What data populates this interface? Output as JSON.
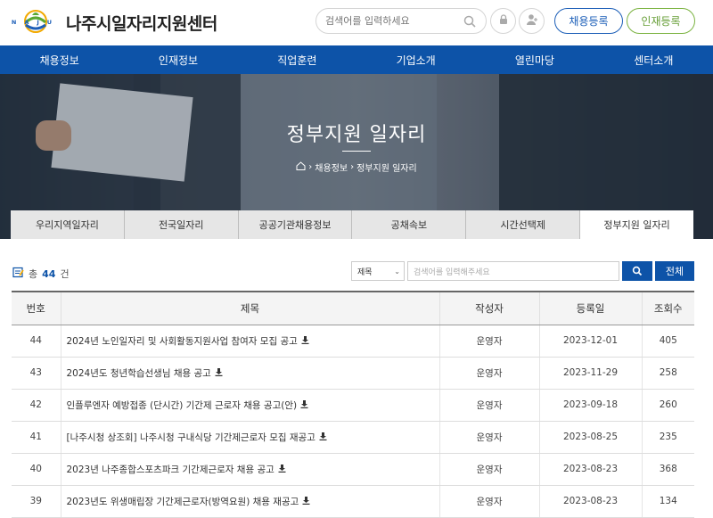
{
  "brand": {
    "logo_text": "NAJU",
    "title": "나주시일자리지원센터"
  },
  "top_search": {
    "placeholder": "검색어를 입력하세요"
  },
  "top_buttons": {
    "register_job": "채용등록",
    "register_talent": "인재등록"
  },
  "nav": [
    "채용정보",
    "인재정보",
    "직업훈련",
    "기업소개",
    "열린마당",
    "센터소개"
  ],
  "banner": {
    "title": "정부지원 일자리",
    "breadcrumb": [
      "채용정보",
      "정부지원 일자리"
    ]
  },
  "tabs": [
    {
      "label": "우리지역일자리",
      "active": false
    },
    {
      "label": "전국일자리",
      "active": false
    },
    {
      "label": "공공기관채용정보",
      "active": false
    },
    {
      "label": "공채속보",
      "active": false
    },
    {
      "label": "시간선택제",
      "active": false
    },
    {
      "label": "정부지원 일자리",
      "active": true
    }
  ],
  "list": {
    "count_prefix": "총",
    "count": "44",
    "count_suffix": "건",
    "select_value": "제목",
    "search_placeholder": "검색어를 입력해주세요",
    "all_button": "전체"
  },
  "table": {
    "headers": [
      "번호",
      "제목",
      "작성자",
      "등록일",
      "조회수"
    ],
    "rows": [
      {
        "no": "44",
        "title": "2024년 노인일자리 및 사회활동지원사업 참여자 모집 공고",
        "author": "운영자",
        "date": "2023-12-01",
        "views": "405"
      },
      {
        "no": "43",
        "title": "2024년도 청년학습선생님 채용 공고",
        "author": "운영자",
        "date": "2023-11-29",
        "views": "258"
      },
      {
        "no": "42",
        "title": "인플루엔자 예방접종 (단시간) 기간제 근로자 채용 공고(안)",
        "author": "운영자",
        "date": "2023-09-18",
        "views": "260"
      },
      {
        "no": "41",
        "title": "[나주시청 상조회] 나주시청 구내식당 기간제근로자 모집 재공고",
        "author": "운영자",
        "date": "2023-08-25",
        "views": "235"
      },
      {
        "no": "40",
        "title": "2023년 나주종합스포츠파크 기간제근로자 채용 공고",
        "author": "운영자",
        "date": "2023-08-23",
        "views": "368"
      },
      {
        "no": "39",
        "title": "2023년도 위생매립장 기간제근로자(방역요원) 채용 재공고",
        "author": "운영자",
        "date": "2023-08-23",
        "views": "134"
      }
    ]
  },
  "colors": {
    "brand_blue": "#0d53a8",
    "green": "#7cb342"
  }
}
